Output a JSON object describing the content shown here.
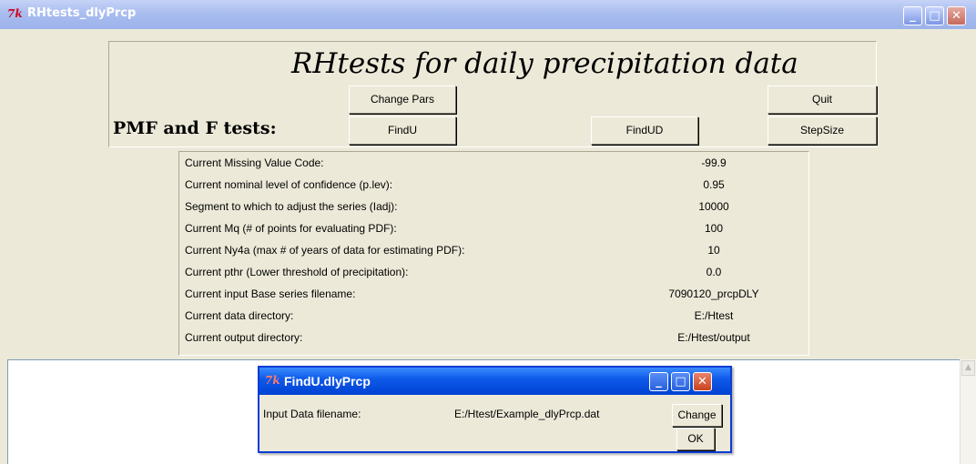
{
  "window": {
    "title": "RHtests_dlyPrcp",
    "logo_text": "7k"
  },
  "main": {
    "heading": "RHtests for daily precipitation data",
    "section_label": "PMF and F tests:",
    "buttons": {
      "change_pars": "Change Pars",
      "quit": "Quit",
      "findu": "FindU",
      "findud": "FindUD",
      "stepsize": "StepSize"
    }
  },
  "params": [
    {
      "label": "Current Missing Value Code:",
      "value": "-99.9"
    },
    {
      "label": "Current nominal level of confidence (p.lev):",
      "value": "0.95"
    },
    {
      "label": "Segment to which to adjust the series (Iadj):",
      "value": "10000"
    },
    {
      "label": "Current Mq (# of points for evaluating PDF):",
      "value": "100"
    },
    {
      "label": "Current Ny4a (max # of years of data for estimating PDF):",
      "value": "10"
    },
    {
      "label": "Current pthr (Lower threshold of precipitation):",
      "value": "0.0"
    },
    {
      "label": "Current input Base series filename:",
      "value": "7090120_prcpDLY"
    },
    {
      "label": "Current data directory:",
      "value": "E:/Htest"
    },
    {
      "label": "Current output directory:",
      "value": "E:/Htest/output"
    }
  ],
  "dialog": {
    "title": "FindU.dlyPrcp",
    "logo_text": "7k",
    "field_label": "Input Data filename:",
    "field_value": "E:/Htest/Example_dlyPrcp.dat",
    "change_label": "Change",
    "ok_label": "OK"
  }
}
